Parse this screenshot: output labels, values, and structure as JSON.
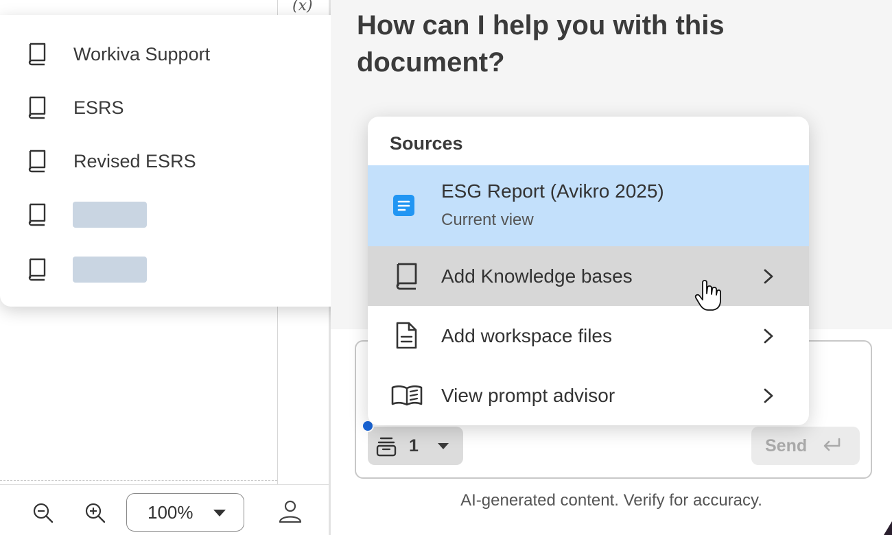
{
  "left_pane": {
    "variable_icon": "(x)",
    "toolbar": {
      "zoom_out_icon": "zoom-out-icon",
      "zoom_in_icon": "zoom-in-icon",
      "zoom_value": "100%",
      "user_icon": "user-icon"
    }
  },
  "knowledge_bases": {
    "items": [
      {
        "label": "Workiva Support",
        "icon": "book-icon"
      },
      {
        "label": "ESRS",
        "icon": "book-icon"
      },
      {
        "label": "Revised ESRS",
        "icon": "book-icon"
      },
      {
        "label": "",
        "icon": "book-icon",
        "loading": true
      },
      {
        "label": "",
        "icon": "book-icon",
        "loading": true
      }
    ]
  },
  "assistant": {
    "headline": "How can I help you with this document?",
    "sources_button": {
      "count": "1",
      "icon": "sources-stack-icon"
    },
    "send_button": {
      "label": "Send",
      "icon": "enter-icon"
    },
    "disclaimer": "AI-generated content. Verify for accuracy."
  },
  "sources_menu": {
    "title": "Sources",
    "current": {
      "title": "ESG Report (Avikro 2025)",
      "subtitle": "Current view",
      "icon": "document-icon"
    },
    "items": [
      {
        "label": "Add Knowledge bases",
        "icon": "book-icon"
      },
      {
        "label": "Add workspace files",
        "icon": "file-icon"
      },
      {
        "label": "View prompt advisor",
        "icon": "open-book-icon"
      }
    ]
  },
  "colors": {
    "selected_bg": "#c3e0fb",
    "hover_bg": "#d7d7d7",
    "accent_blue": "#2196f3",
    "skeleton": "#c9d5e2"
  }
}
